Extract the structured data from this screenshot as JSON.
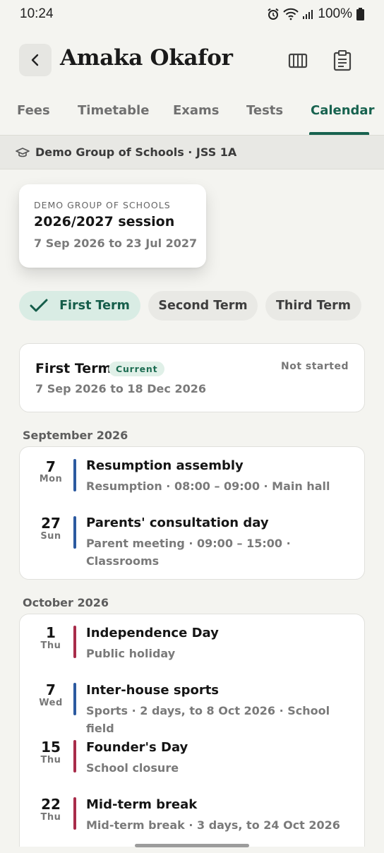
{
  "status_bar": {
    "time": "10:24",
    "battery": "100%"
  },
  "header": {
    "title": "Amaka Okafor"
  },
  "tabs": [
    {
      "label": "Fees"
    },
    {
      "label": "Timetable"
    },
    {
      "label": "Exams"
    },
    {
      "label": "Tests"
    },
    {
      "label": "Calendar"
    }
  ],
  "active_tab": "Calendar",
  "school_bar": {
    "text": "Demo Group of Schools · JSS 1A"
  },
  "session": {
    "org": "DEMO GROUP OF SCHOOLS",
    "title": "2026/2027 session",
    "dates": "7 Sep 2026 to 23 Jul 2027"
  },
  "terms": [
    {
      "label": "First Term",
      "selected": true
    },
    {
      "label": "Second Term",
      "selected": false
    },
    {
      "label": "Third Term",
      "selected": false
    }
  ],
  "term_summary": {
    "name": "First Term",
    "badge": "Current",
    "status": "Not started",
    "dates": "7 Sep 2026 to 18 Dec 2026"
  },
  "months": [
    {
      "label": "September 2026",
      "events": [
        {
          "day": "7",
          "dow": "Mon",
          "color": "#2c5aa0",
          "title": "Resumption assembly",
          "detail": "Resumption · 08:00 – 09:00 · Main hall"
        },
        {
          "day": "27",
          "dow": "Sun",
          "color": "#2c5aa0",
          "title": "Parents' consultation day",
          "detail": "Parent meeting · 09:00 – 15:00 · Classrooms"
        }
      ]
    },
    {
      "label": "October 2026",
      "events": [
        {
          "day": "1",
          "dow": "Thu",
          "color": "#a82c4a",
          "title": "Independence Day",
          "detail": "Public holiday"
        },
        {
          "day": "7",
          "dow": "Wed",
          "color": "#2c5aa0",
          "title": "Inter-house sports",
          "detail": "Sports · 2 days, to 8 Oct 2026 · School field"
        },
        {
          "day": "15",
          "dow": "Thu",
          "color": "#a82c4a",
          "title": "Founder's Day",
          "detail": "School closure"
        },
        {
          "day": "22",
          "dow": "Thu",
          "color": "#a82c4a",
          "title": "Mid-term break",
          "detail": "Mid-term break · 3 days, to 24 Oct 2026"
        }
      ]
    }
  ],
  "icons": {
    "back": "chevron-left-icon",
    "columns": "columns-icon",
    "clipboard": "clipboard-icon",
    "school": "graduation-cap-icon",
    "check": "check-icon"
  },
  "colors": {
    "accent": "#17624f",
    "chip_selected_bg": "#d9ece4",
    "badge_bg": "#e0f0e8",
    "event_blue": "#2c5aa0",
    "event_red": "#a82c4a"
  }
}
